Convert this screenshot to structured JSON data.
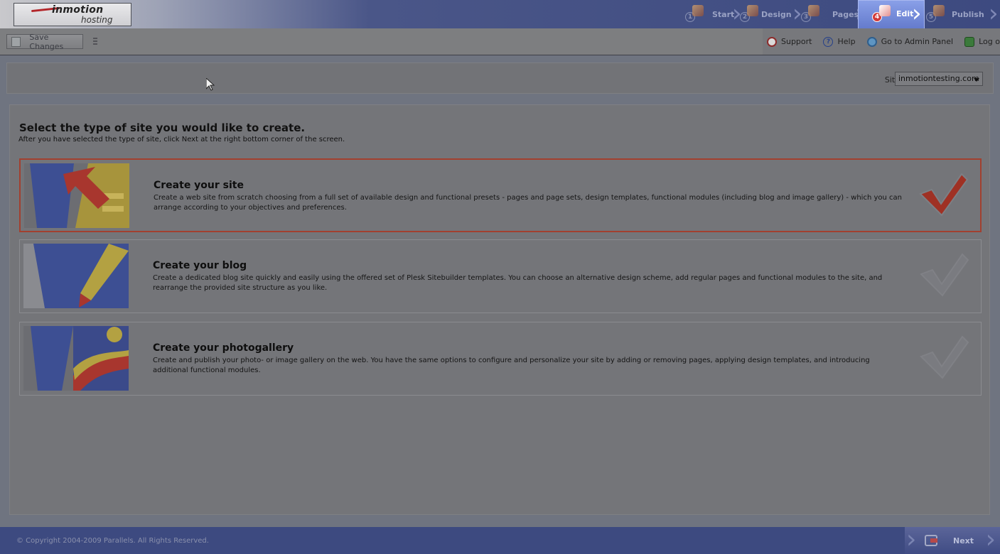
{
  "brand": {
    "logo_main": "inmotion",
    "logo_sub": "hosting"
  },
  "wizard": {
    "steps": [
      {
        "num": "1",
        "label": "Start",
        "active": false
      },
      {
        "num": "2",
        "label": "Design",
        "active": false
      },
      {
        "num": "3",
        "label": "Pages",
        "active": false
      },
      {
        "num": "4",
        "label": "Edit",
        "active": true
      },
      {
        "num": "5",
        "label": "Publish",
        "active": false
      }
    ]
  },
  "toolbar": {
    "save_label": "Save Changes",
    "links": [
      {
        "label": "Support",
        "icon": "support-icon"
      },
      {
        "label": "Help",
        "icon": "help-icon"
      },
      {
        "label": "Go to Admin Panel",
        "icon": "admin-panel-icon"
      },
      {
        "label": "Log out",
        "icon": "logout-icon"
      }
    ]
  },
  "site_selector": {
    "label": "Site",
    "value": "inmotiontesting.com"
  },
  "main": {
    "heading": "Select the type of site you would like to create.",
    "subheading": "After you have selected the type of site, click Next at the right bottom corner of the screen.",
    "options": [
      {
        "title": "Create your site",
        "description": "Create a web site from scratch choosing from a full set of available design and functional presets - pages and page sets, design templates, functional modules (including blog and image gallery) - which you can arrange according to your objectives and preferences.",
        "selected": true
      },
      {
        "title": "Create your blog",
        "description": "Create a dedicated blog site quickly and easily using the offered set of Plesk Sitebuilder templates. You can choose an alternative design scheme, add regular pages and functional modules to the site, and rearrange the provided site structure as you like.",
        "selected": false
      },
      {
        "title": "Create your photogallery",
        "description": "Create and publish your photo- or image gallery on the web. You have the same options to configure and personalize your site by adding or removing pages, applying design templates, and introducing additional functional modules.",
        "selected": false
      }
    ]
  },
  "footer": {
    "copyright": "© Copyright 2004-2009 Parallels. All Rights Reserved.",
    "next_label": "Next"
  },
  "colors": {
    "header_blue": "#3d4a80",
    "active_step": "#6f84d6",
    "selected_border": "#a2402f",
    "check_red": "#c0392b"
  }
}
